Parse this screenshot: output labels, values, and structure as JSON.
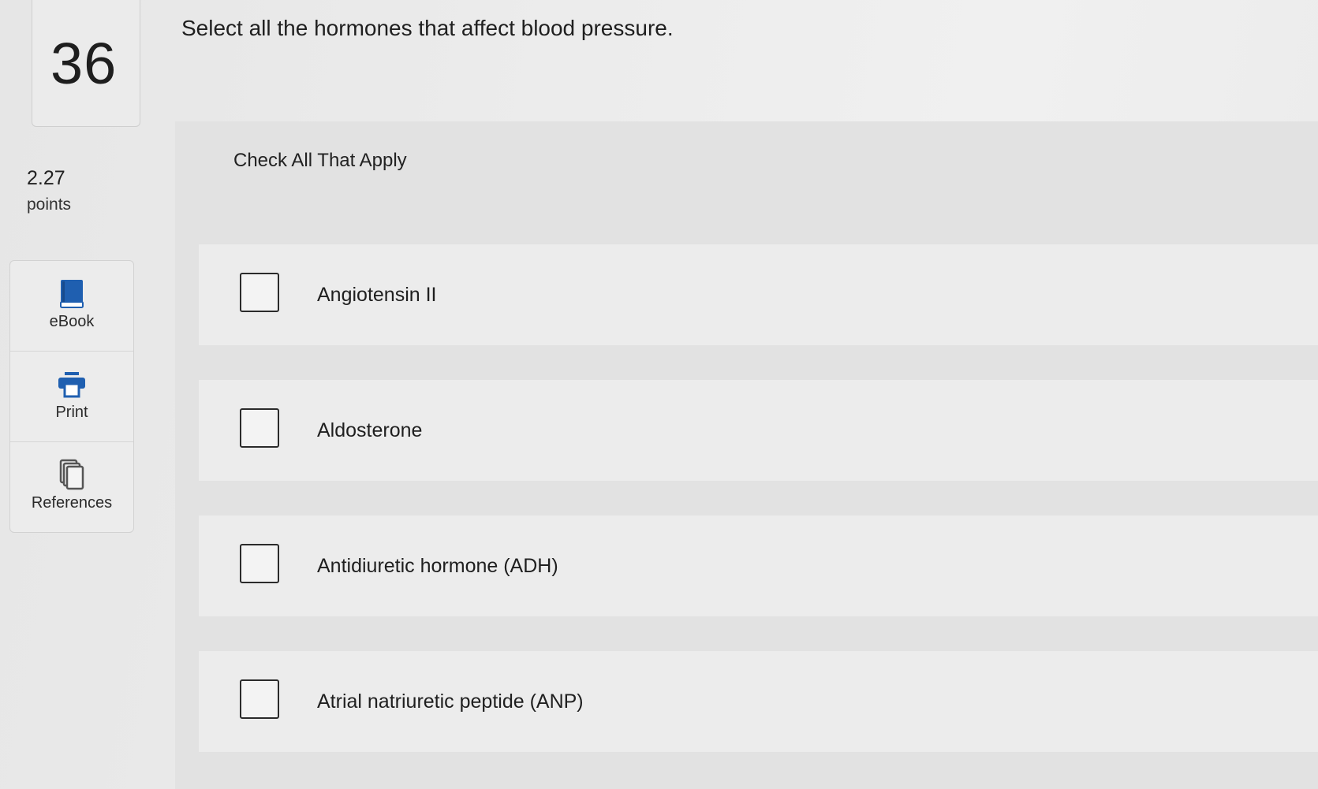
{
  "question": {
    "number": "36",
    "points_value": "2.27",
    "points_label": "points",
    "text": "Select all the hormones that affect blood pressure.",
    "instruction": "Check All That Apply"
  },
  "tools": [
    {
      "label": "eBook",
      "icon": "book-icon"
    },
    {
      "label": "Print",
      "icon": "printer-icon"
    },
    {
      "label": "References",
      "icon": "copy-pages-icon"
    }
  ],
  "options": [
    {
      "label": "Angiotensin II",
      "checked": false
    },
    {
      "label": "Aldosterone",
      "checked": false
    },
    {
      "label": "Antidiuretic hormone (ADH)",
      "checked": false
    },
    {
      "label": "Atrial natriuretic peptide (ANP)",
      "checked": false
    }
  ],
  "colors": {
    "ebook_icon": "#1f5fb0",
    "print_icon": "#1f5fb0",
    "references_icon": "#555555"
  }
}
